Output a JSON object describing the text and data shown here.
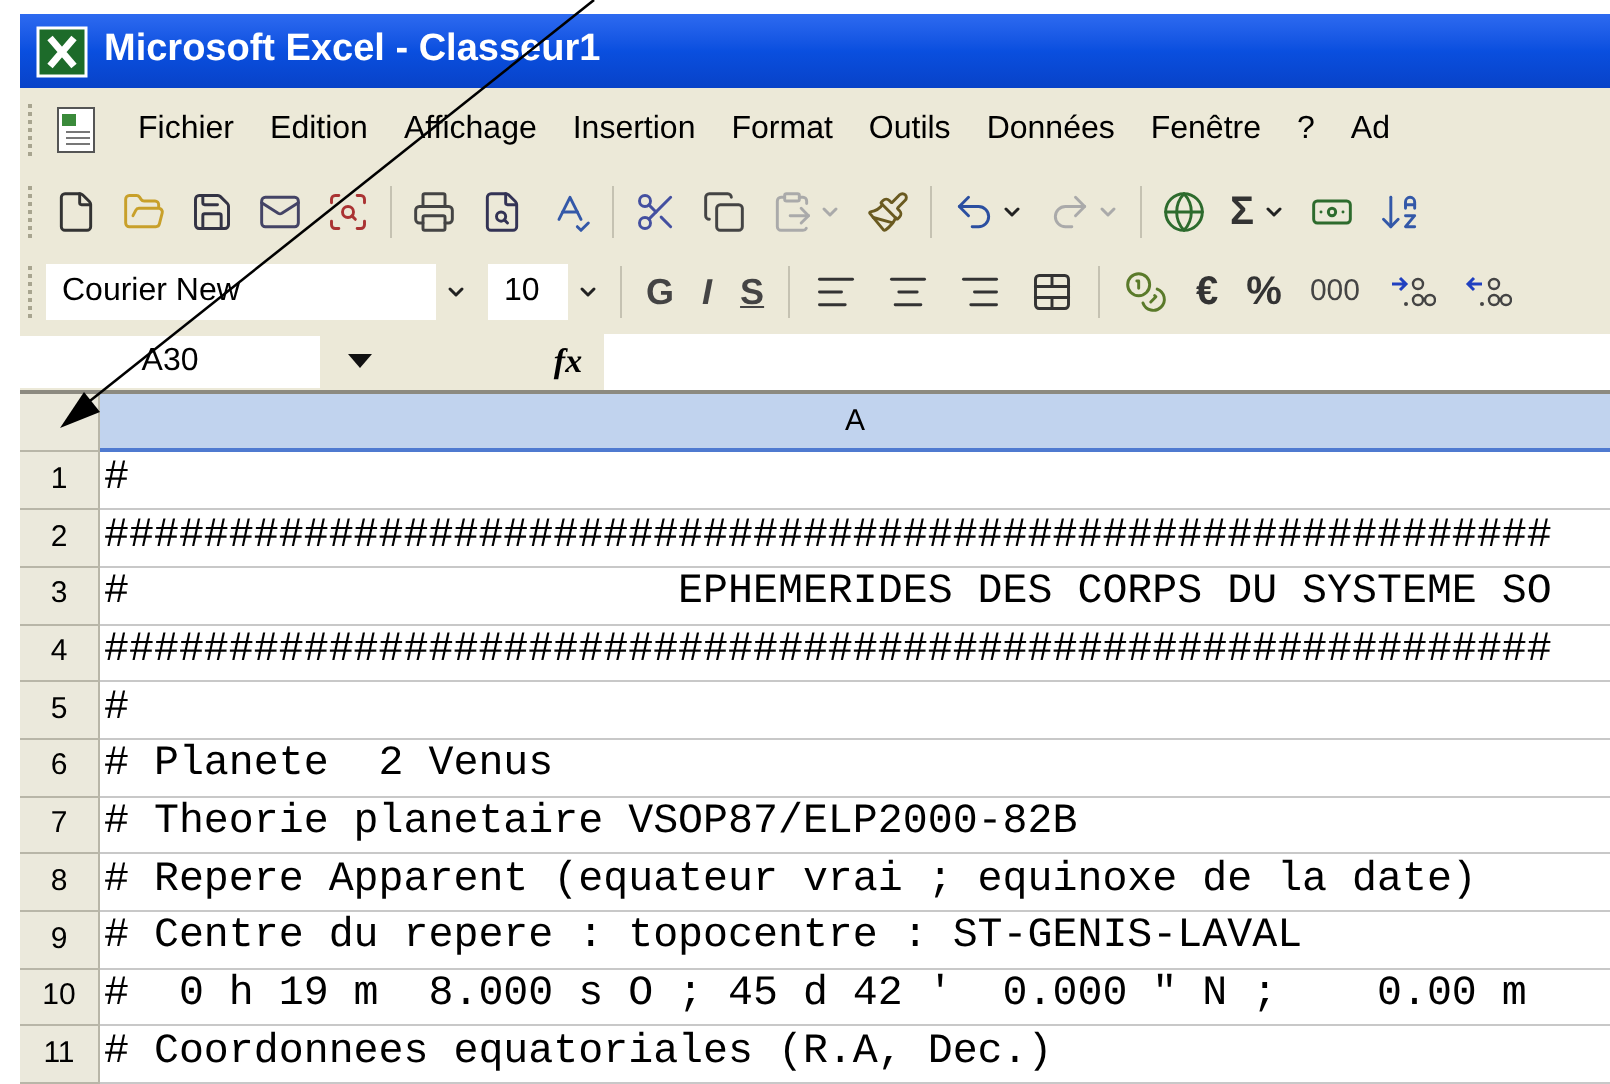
{
  "window": {
    "title": "Microsoft Excel - Classeur1"
  },
  "menu": [
    "Fichier",
    "Edition",
    "Affichage",
    "Insertion",
    "Format",
    "Outils",
    "Données",
    "Fenêtre",
    "?",
    "Ad"
  ],
  "toolbar": [
    {
      "kind": "new",
      "disabled": false
    },
    {
      "kind": "open",
      "disabled": false
    },
    {
      "kind": "save",
      "disabled": false
    },
    {
      "kind": "mail",
      "disabled": false
    },
    {
      "kind": "research",
      "disabled": false
    },
    {
      "kind": "sep"
    },
    {
      "kind": "print",
      "disabled": false
    },
    {
      "kind": "preview",
      "disabled": false
    },
    {
      "kind": "spelling",
      "disabled": false
    },
    {
      "kind": "sep"
    },
    {
      "kind": "cut",
      "disabled": false
    },
    {
      "kind": "copy",
      "disabled": false
    },
    {
      "kind": "paste",
      "disabled": true,
      "dropdown": true
    },
    {
      "kind": "painter",
      "disabled": false
    },
    {
      "kind": "sep"
    },
    {
      "kind": "undo",
      "disabled": false,
      "dropdown": true
    },
    {
      "kind": "redo",
      "disabled": true,
      "dropdown": true
    },
    {
      "kind": "sep"
    },
    {
      "kind": "globe",
      "disabled": false
    },
    {
      "kind": "text",
      "label": "Σ",
      "disabled": false,
      "dropdown": true
    },
    {
      "kind": "converter",
      "disabled": false
    },
    {
      "kind": "sort",
      "disabled": false
    }
  ],
  "format_toolbar": {
    "font": "Courier New",
    "size": "10",
    "buttons": [
      {
        "kind": "bold",
        "label": "G"
      },
      {
        "kind": "italic",
        "label": "I"
      },
      {
        "kind": "underline",
        "label": "S"
      },
      {
        "kind": "sep"
      },
      {
        "kind": "align-left"
      },
      {
        "kind": "align-center"
      },
      {
        "kind": "align-right"
      },
      {
        "kind": "merge"
      },
      {
        "kind": "sep"
      },
      {
        "kind": "currency"
      },
      {
        "kind": "text",
        "label": "€"
      },
      {
        "kind": "text",
        "label": "%"
      },
      {
        "kind": "thin",
        "label": "000"
      },
      {
        "kind": "add-decimal"
      },
      {
        "kind": "remove-decimal"
      }
    ]
  },
  "formula_bar": {
    "name_box": "A30",
    "fx": "fx"
  },
  "sheet": {
    "columns": [
      {
        "label": "A",
        "selected": true
      }
    ],
    "rows": [
      {
        "number": "1",
        "text": "#"
      },
      {
        "number": "2",
        "text": "##########################################################"
      },
      {
        "number": "3",
        "text": "#                      EPHEMERIDES DES CORPS DU SYSTEME SO"
      },
      {
        "number": "4",
        "text": "##########################################################"
      },
      {
        "number": "5",
        "text": "#"
      },
      {
        "number": "6",
        "text": "# Planete  2 Venus"
      },
      {
        "number": "7",
        "text": "# Theorie planetaire VSOP87/ELP2000-82B"
      },
      {
        "number": "8",
        "text": "# Repere Apparent (equateur vrai ; equinoxe de la date)"
      },
      {
        "number": "9",
        "text": "# Centre du repere : topocentre : ST-GENIS-LAVAL"
      },
      {
        "number": "10",
        "text": "#  0 h 19 m  8.000 s O ; 45 d 42 '  0.000 \" N ;    0.00 m"
      },
      {
        "number": "11",
        "text": "# Coordonnees equatoriales (R.A, Dec.)"
      }
    ]
  }
}
